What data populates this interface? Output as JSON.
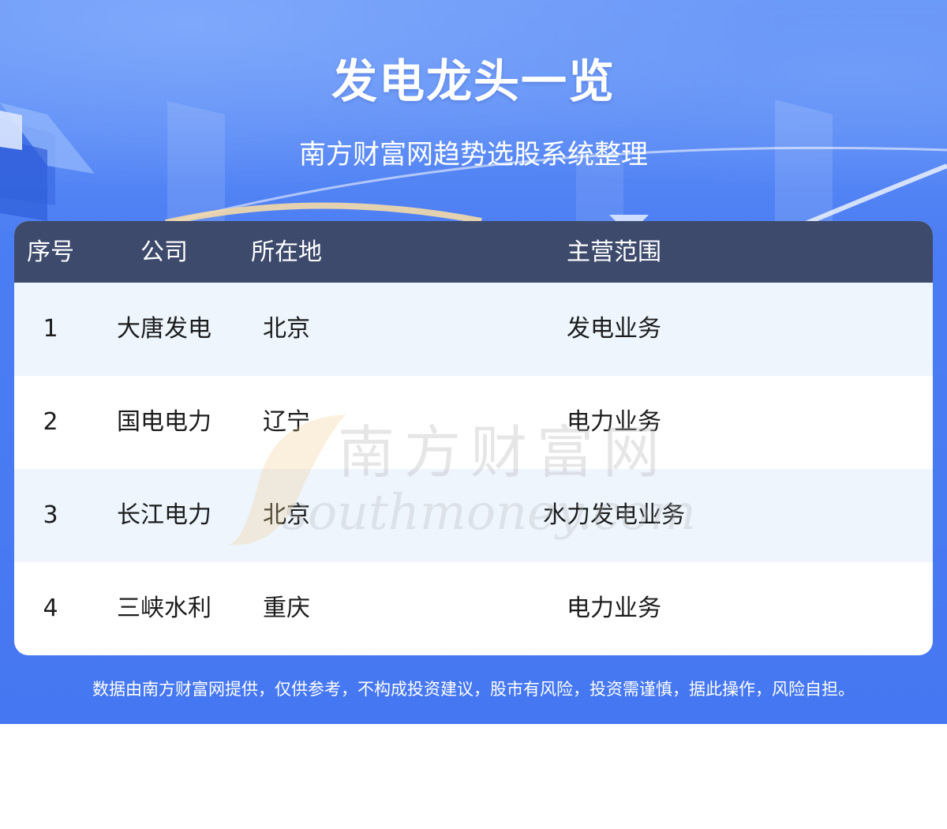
{
  "header": {
    "title": "发电龙头一览",
    "subtitle": "南方财富网趋势选股系统整理"
  },
  "table": {
    "columns": [
      "序号",
      "公司",
      "所在地",
      "主营范围"
    ],
    "rows": [
      {
        "index": "1",
        "company": "大唐发电",
        "location": "北京",
        "business": "发电业务"
      },
      {
        "index": "2",
        "company": "国电电力",
        "location": "辽宁",
        "business": "电力业务"
      },
      {
        "index": "3",
        "company": "长江电力",
        "location": "北京",
        "business": "水力发电业务"
      },
      {
        "index": "4",
        "company": "三峡水利",
        "location": "重庆",
        "business": "电力业务"
      }
    ]
  },
  "watermark": {
    "cn": "南方财富网",
    "en": "southmoney.com"
  },
  "footer": {
    "disclaimer": "数据由南方财富网提供，仅供参考，不构成投资建议，股市有风险，投资需谨慎，据此操作，风险自担。"
  },
  "colors": {
    "background_blue": "#4677f2",
    "header_row": "#3d4a6c",
    "alt_row": "#eef5fd",
    "text_dark": "#1c1c1c",
    "white": "#ffffff"
  }
}
